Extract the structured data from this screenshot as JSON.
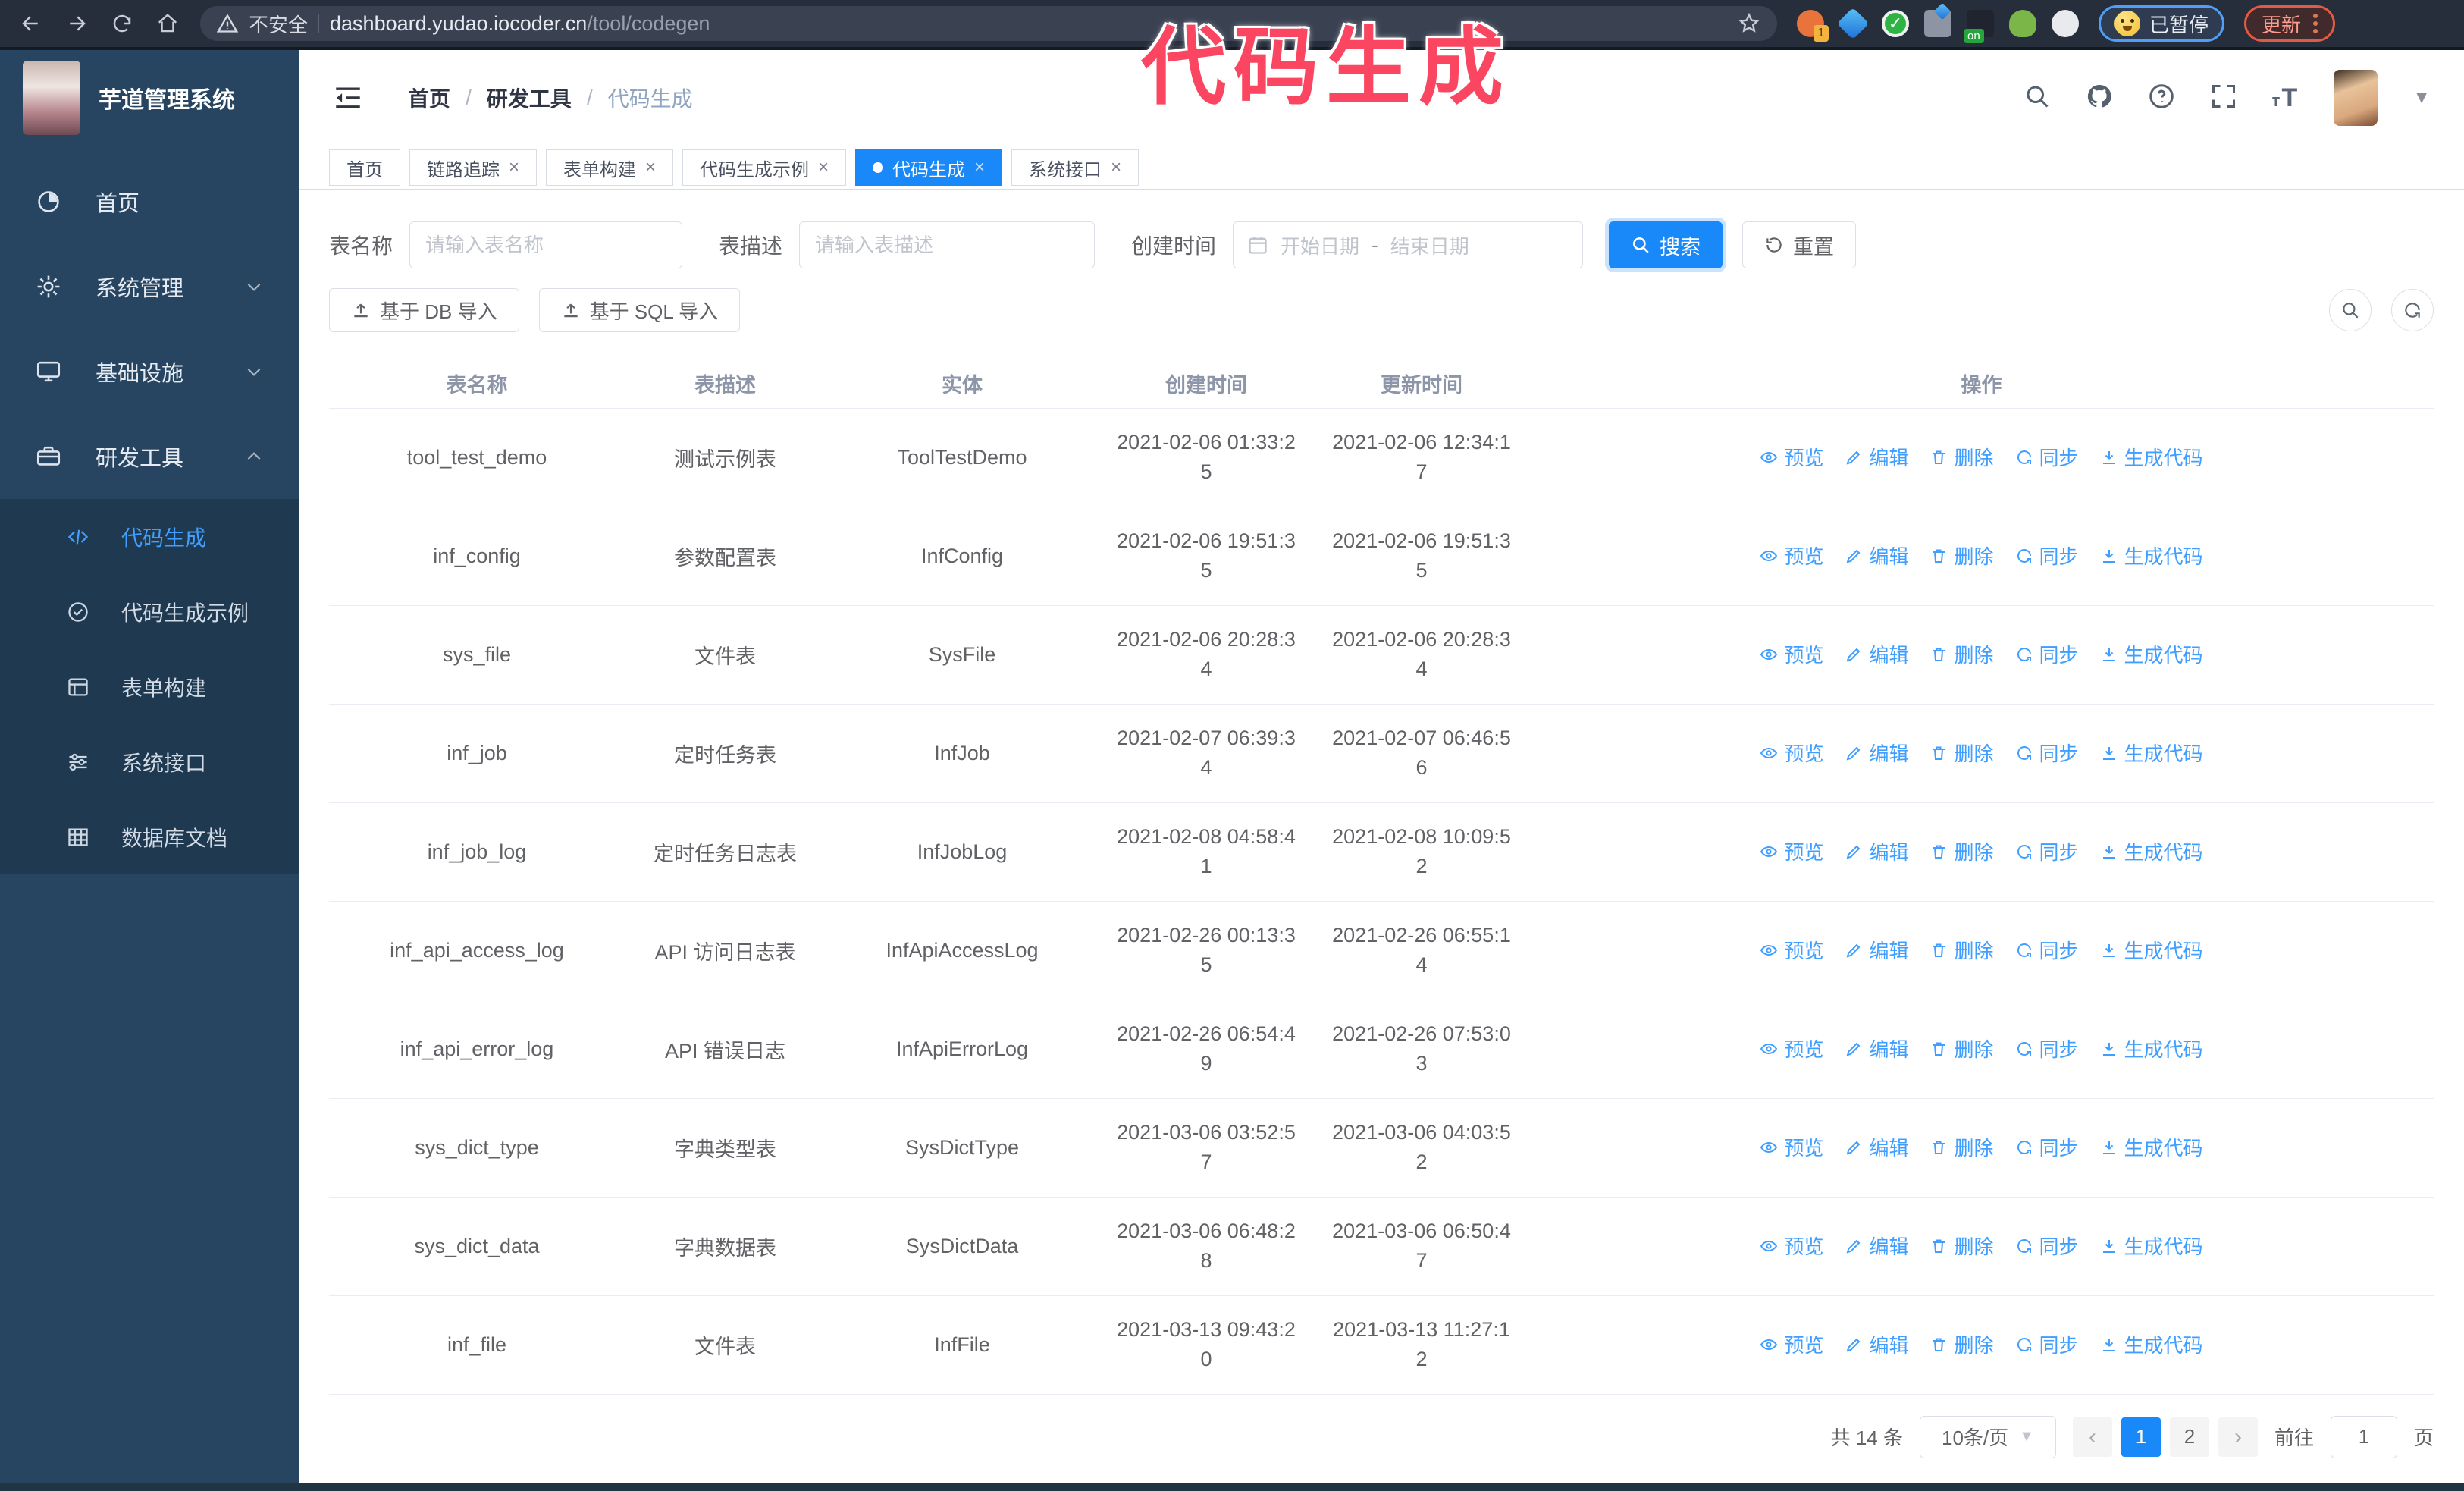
{
  "browser": {
    "security_label": "不安全",
    "url_host": "dashboard.yudao.iocoder.cn",
    "url_path": "/tool/codegen",
    "extension_badge": "1",
    "extension_on_badge": "on",
    "profile_label": "已暂停",
    "update_label": "更新"
  },
  "annotation": {
    "text": "代码生成"
  },
  "logo": {
    "title": "芋道管理系统"
  },
  "breadcrumb": {
    "separator": "/",
    "items": [
      "首页",
      "研发工具",
      "代码生成"
    ]
  },
  "sidebar": {
    "items": [
      {
        "label": "首页",
        "icon": "dashboard-icon"
      },
      {
        "label": "系统管理",
        "icon": "gear-icon",
        "chevron": "down"
      },
      {
        "label": "基础设施",
        "icon": "monitor-icon",
        "chevron": "down"
      },
      {
        "label": "研发工具",
        "icon": "toolbox-icon",
        "chevron": "up",
        "expanded": true,
        "children": [
          {
            "label": "代码生成",
            "icon": "code-icon",
            "active": true
          },
          {
            "label": "代码生成示例",
            "icon": "example-icon"
          },
          {
            "label": "表单构建",
            "icon": "form-icon"
          },
          {
            "label": "系统接口",
            "icon": "api-icon"
          },
          {
            "label": "数据库文档",
            "icon": "database-icon"
          }
        ]
      }
    ]
  },
  "tabs": [
    {
      "label": "首页",
      "closable": false,
      "active": false
    },
    {
      "label": "链路追踪",
      "closable": true,
      "active": false
    },
    {
      "label": "表单构建",
      "closable": true,
      "active": false
    },
    {
      "label": "代码生成示例",
      "closable": true,
      "active": false
    },
    {
      "label": "代码生成",
      "closable": true,
      "active": true
    },
    {
      "label": "系统接口",
      "closable": true,
      "active": false
    }
  ],
  "filters": {
    "table_name_label": "表名称",
    "table_name_placeholder": "请输入表名称",
    "table_desc_label": "表描述",
    "table_desc_placeholder": "请输入表描述",
    "create_time_label": "创建时间",
    "start_placeholder": "开始日期",
    "range_separator": "-",
    "end_placeholder": "结束日期",
    "search_label": "搜索",
    "reset_label": "重置"
  },
  "toolbar": {
    "import_db_label": "基于 DB 导入",
    "import_sql_label": "基于 SQL 导入"
  },
  "table": {
    "headers": [
      "表名称",
      "表描述",
      "实体",
      "创建时间",
      "更新时间",
      "操作"
    ],
    "action_labels": [
      "预览",
      "编辑",
      "删除",
      "同步",
      "生成代码"
    ],
    "rows": [
      {
        "name": "tool_test_demo",
        "desc": "测试示例表",
        "entity": "ToolTestDemo",
        "created": "2021-02-06 01:33:25",
        "updated": "2021-02-06 12:34:17"
      },
      {
        "name": "inf_config",
        "desc": "参数配置表",
        "entity": "InfConfig",
        "created": "2021-02-06 19:51:35",
        "updated": "2021-02-06 19:51:35"
      },
      {
        "name": "sys_file",
        "desc": "文件表",
        "entity": "SysFile",
        "created": "2021-02-06 20:28:34",
        "updated": "2021-02-06 20:28:34"
      },
      {
        "name": "inf_job",
        "desc": "定时任务表",
        "entity": "InfJob",
        "created": "2021-02-07 06:39:34",
        "updated": "2021-02-07 06:46:56"
      },
      {
        "name": "inf_job_log",
        "desc": "定时任务日志表",
        "entity": "InfJobLog",
        "created": "2021-02-08 04:58:41",
        "updated": "2021-02-08 10:09:52"
      },
      {
        "name": "inf_api_access_log",
        "desc": "API 访问日志表",
        "entity": "InfApiAccessLog",
        "created": "2021-02-26 00:13:35",
        "updated": "2021-02-26 06:55:14"
      },
      {
        "name": "inf_api_error_log",
        "desc": "API 错误日志",
        "entity": "InfApiErrorLog",
        "created": "2021-02-26 06:54:49",
        "updated": "2021-02-26 07:53:03"
      },
      {
        "name": "sys_dict_type",
        "desc": "字典类型表",
        "entity": "SysDictType",
        "created": "2021-03-06 03:52:57",
        "updated": "2021-03-06 04:03:52"
      },
      {
        "name": "sys_dict_data",
        "desc": "字典数据表",
        "entity": "SysDictData",
        "created": "2021-03-06 06:48:28",
        "updated": "2021-03-06 06:50:47"
      },
      {
        "name": "inf_file",
        "desc": "文件表",
        "entity": "InfFile",
        "created": "2021-03-13 09:43:20",
        "updated": "2021-03-13 11:27:12"
      }
    ]
  },
  "pagination": {
    "total": "共 14 条",
    "page_size": "10条/页",
    "pages": [
      "1",
      "2"
    ],
    "active_page": "1",
    "goto_label": "前往",
    "goto_value": "1",
    "page_unit": "页"
  },
  "colors": {
    "accent": "#1989fa",
    "sidebar_bg": "#274560",
    "submenu_bg": "#1e3950",
    "annotation": "#fb4661"
  }
}
